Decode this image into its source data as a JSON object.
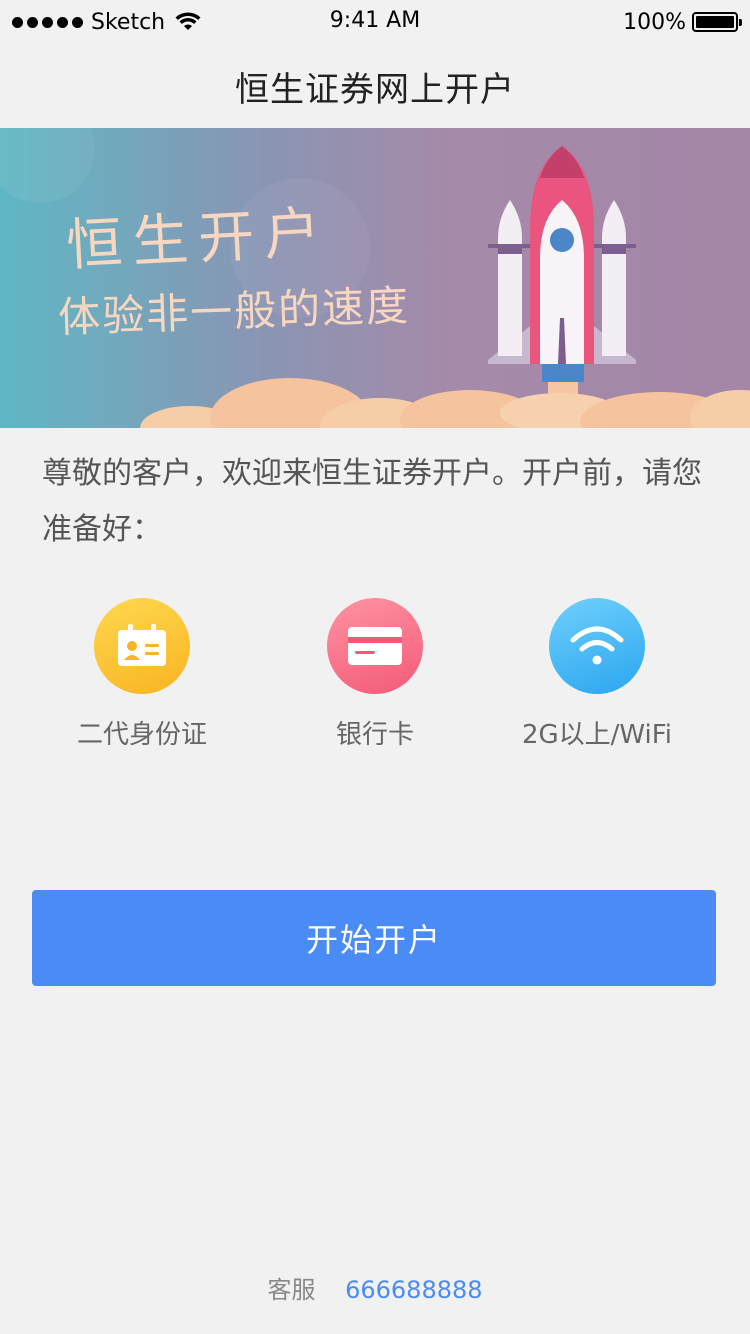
{
  "status_bar": {
    "carrier": "Sketch",
    "time": "9:41 AM",
    "battery": "100%",
    "battery_level": 1.0
  },
  "nav": {
    "title": "恒生证券网上开户"
  },
  "banner": {
    "headline": "恒生开户",
    "tagline": "体验非一般的速度"
  },
  "intro": {
    "text": "尊敬的客户，欢迎来恒生证券开户。开户前，请您准备好："
  },
  "prep_items": [
    {
      "label": "二代身份证",
      "icon": "id-card-icon",
      "color": "#fbc334"
    },
    {
      "label": "银行卡",
      "icon": "bank-card-icon",
      "color": "#f8718a"
    },
    {
      "label": "2G以上/WiFi",
      "icon": "wifi-icon",
      "color": "#47b7f6"
    }
  ],
  "actions": {
    "start_label": "开始开户",
    "color": "#4a8bf5"
  },
  "footer": {
    "service_label": "客服",
    "phone": "666688888"
  }
}
